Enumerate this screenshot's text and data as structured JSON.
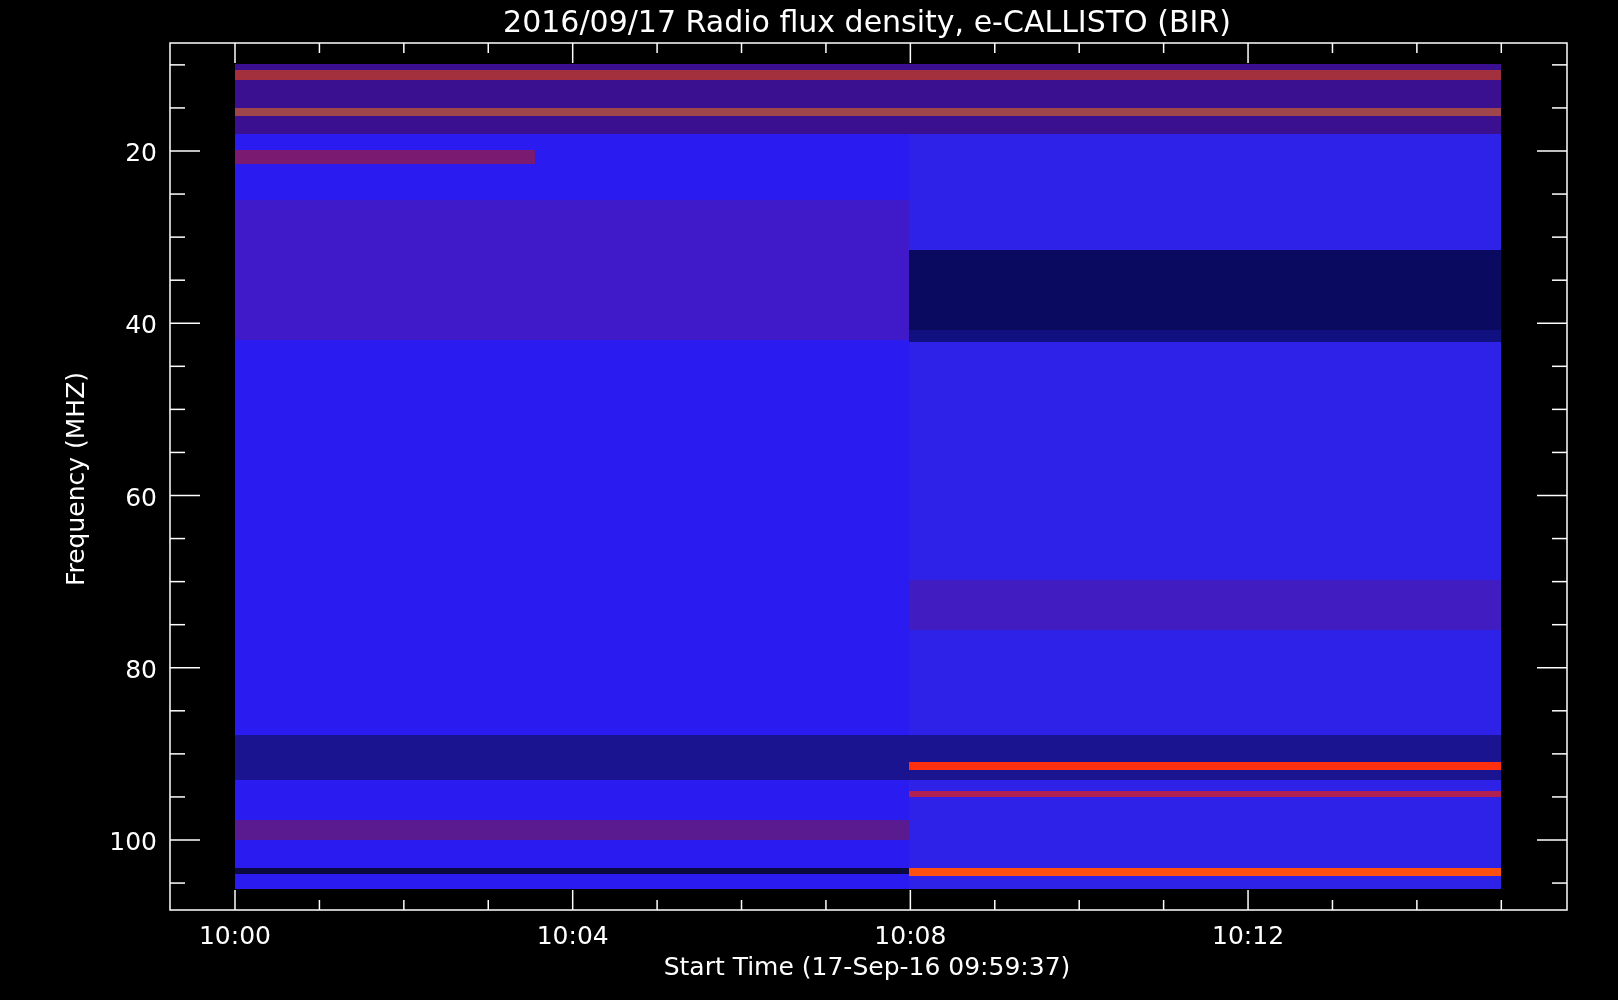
{
  "title": "2016/09/17  Radio flux density, e-CALLISTO (BIR)",
  "y_axis": {
    "label": "Frequency (MHZ)",
    "ticks": [
      "20",
      "40",
      "60",
      "80",
      "100"
    ]
  },
  "x_axis": {
    "label": "Start Time (17-Sep-16 09:59:37)",
    "ticks": [
      "10:00",
      "10:04",
      "10:08",
      "10:12"
    ]
  }
}
